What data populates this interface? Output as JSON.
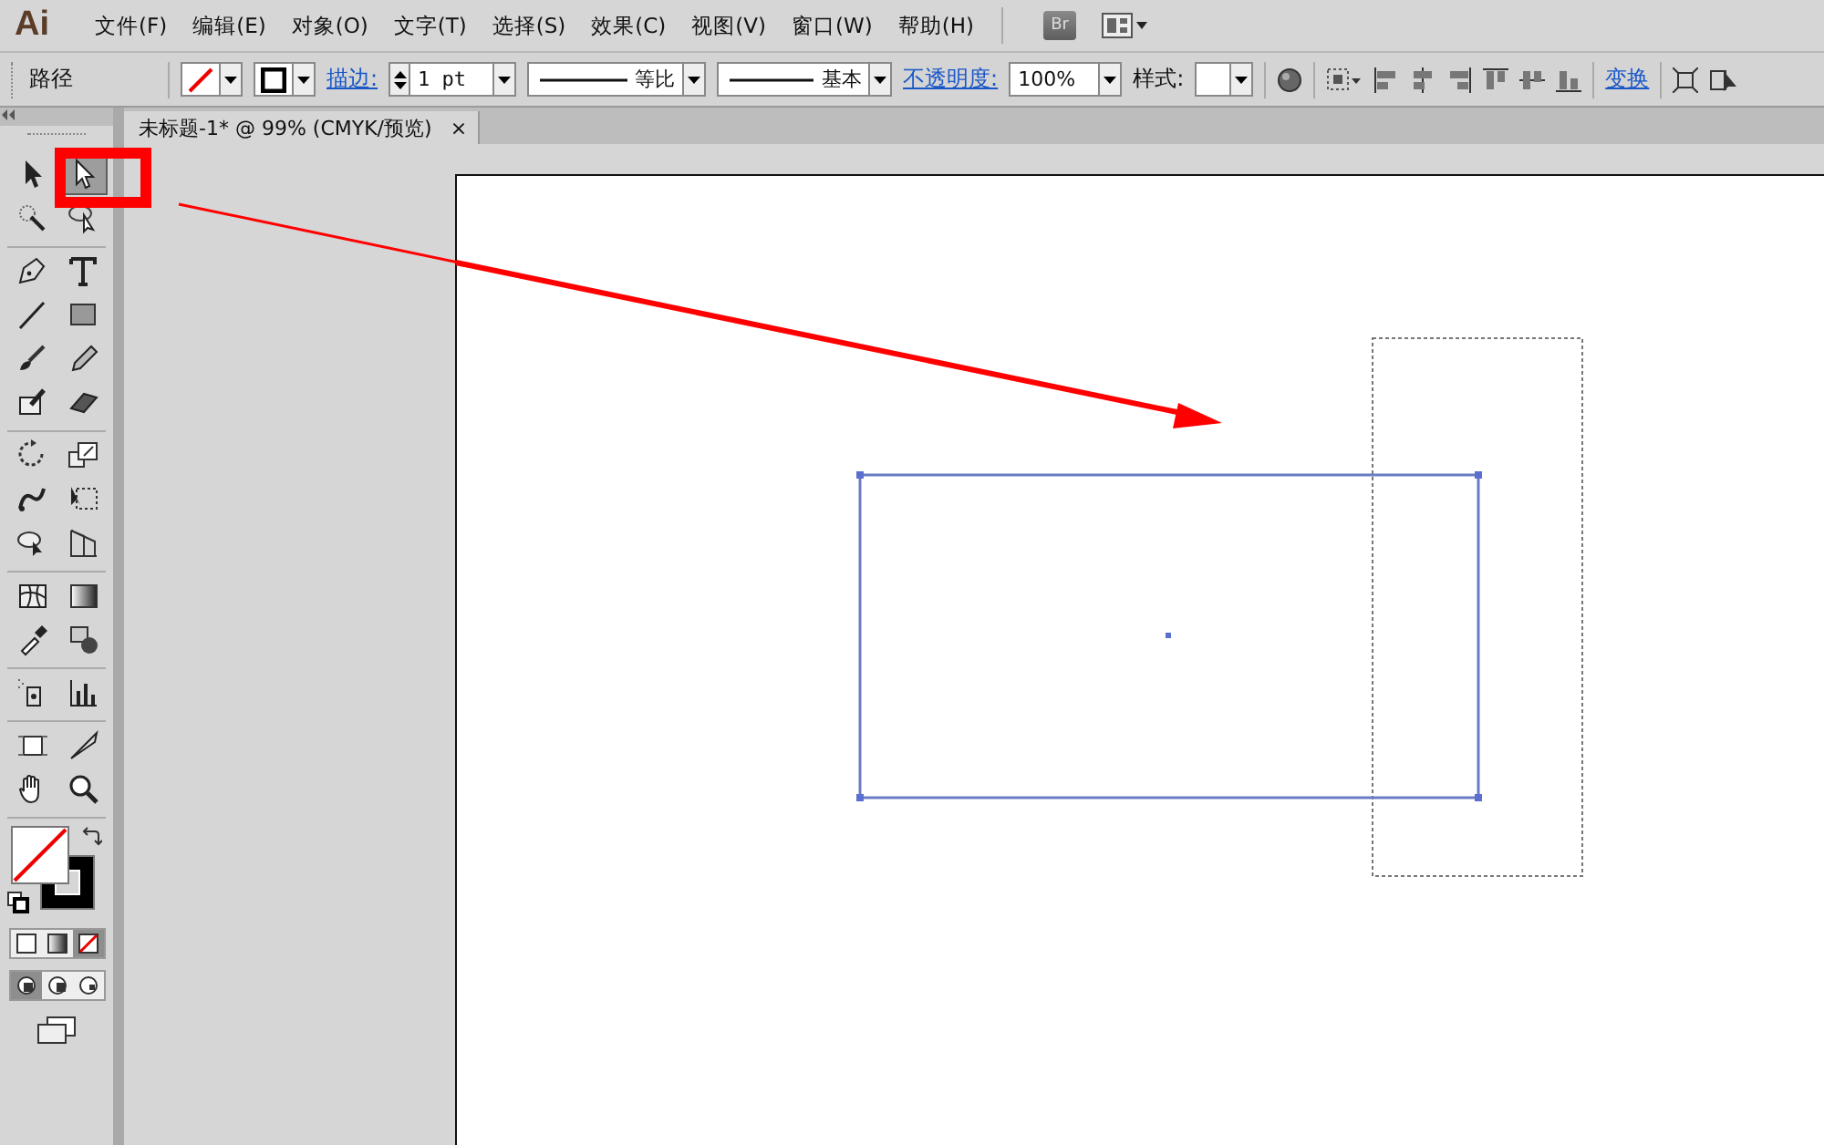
{
  "app_logo": "Ai",
  "menu": [
    "文件(F)",
    "编辑(E)",
    "对象(O)",
    "文字(T)",
    "选择(S)",
    "效果(C)",
    "视图(V)",
    "窗口(W)",
    "帮助(H)"
  ],
  "bridge_button": "Br",
  "control_bar": {
    "selection_label": "路径",
    "stroke_link": "描边:",
    "stroke_weight": "1 pt",
    "profile": "等比",
    "brush": "基本",
    "opacity_link": "不透明度:",
    "opacity": "100%",
    "style_label": "样式:",
    "transform_link": "变换"
  },
  "document_tab": {
    "title": "未标题-1* @ 99% (CMYK/预览)",
    "close": "×"
  },
  "tool_groups": [
    [
      {
        "kind": "selection",
        "selected": false
      },
      {
        "kind": "direct-selection",
        "selected": true
      },
      {
        "kind": "magic-wand",
        "selected": false
      },
      {
        "kind": "lasso",
        "selected": false
      }
    ],
    [
      {
        "kind": "pen",
        "selected": false
      },
      {
        "kind": "type",
        "selected": false
      },
      {
        "kind": "line",
        "selected": false
      },
      {
        "kind": "rectangle",
        "selected": false
      },
      {
        "kind": "paintbrush",
        "selected": false
      },
      {
        "kind": "pencil",
        "selected": false
      },
      {
        "kind": "blob-brush",
        "selected": false
      },
      {
        "kind": "eraser",
        "selected": false
      }
    ],
    [
      {
        "kind": "rotate",
        "selected": false
      },
      {
        "kind": "scale",
        "selected": false
      },
      {
        "kind": "warp",
        "selected": false
      },
      {
        "kind": "free-transform",
        "selected": false
      },
      {
        "kind": "shape-builder",
        "selected": false
      },
      {
        "kind": "perspective",
        "selected": false
      }
    ],
    [
      {
        "kind": "mesh",
        "selected": false
      },
      {
        "kind": "gradient",
        "selected": false
      },
      {
        "kind": "eyedropper",
        "selected": false
      },
      {
        "kind": "blend",
        "selected": false
      }
    ],
    [
      {
        "kind": "sprayer",
        "selected": false
      },
      {
        "kind": "graph",
        "selected": false
      }
    ],
    [
      {
        "kind": "artboard",
        "selected": false
      },
      {
        "kind": "slice",
        "selected": false
      },
      {
        "kind": "hand",
        "selected": false
      },
      {
        "kind": "zoom",
        "selected": false
      }
    ]
  ],
  "fill": {
    "kind": "none"
  },
  "stroke": {
    "kind": "solid"
  },
  "color_modes": [
    {
      "kind": "color",
      "selected": false
    },
    {
      "kind": "gradient",
      "selected": false
    },
    {
      "kind": "none",
      "selected": true
    }
  ],
  "draw_modes": [
    {
      "kind": "normal",
      "selected": true
    },
    {
      "kind": "behind",
      "selected": false
    },
    {
      "kind": "inside",
      "selected": false
    }
  ]
}
